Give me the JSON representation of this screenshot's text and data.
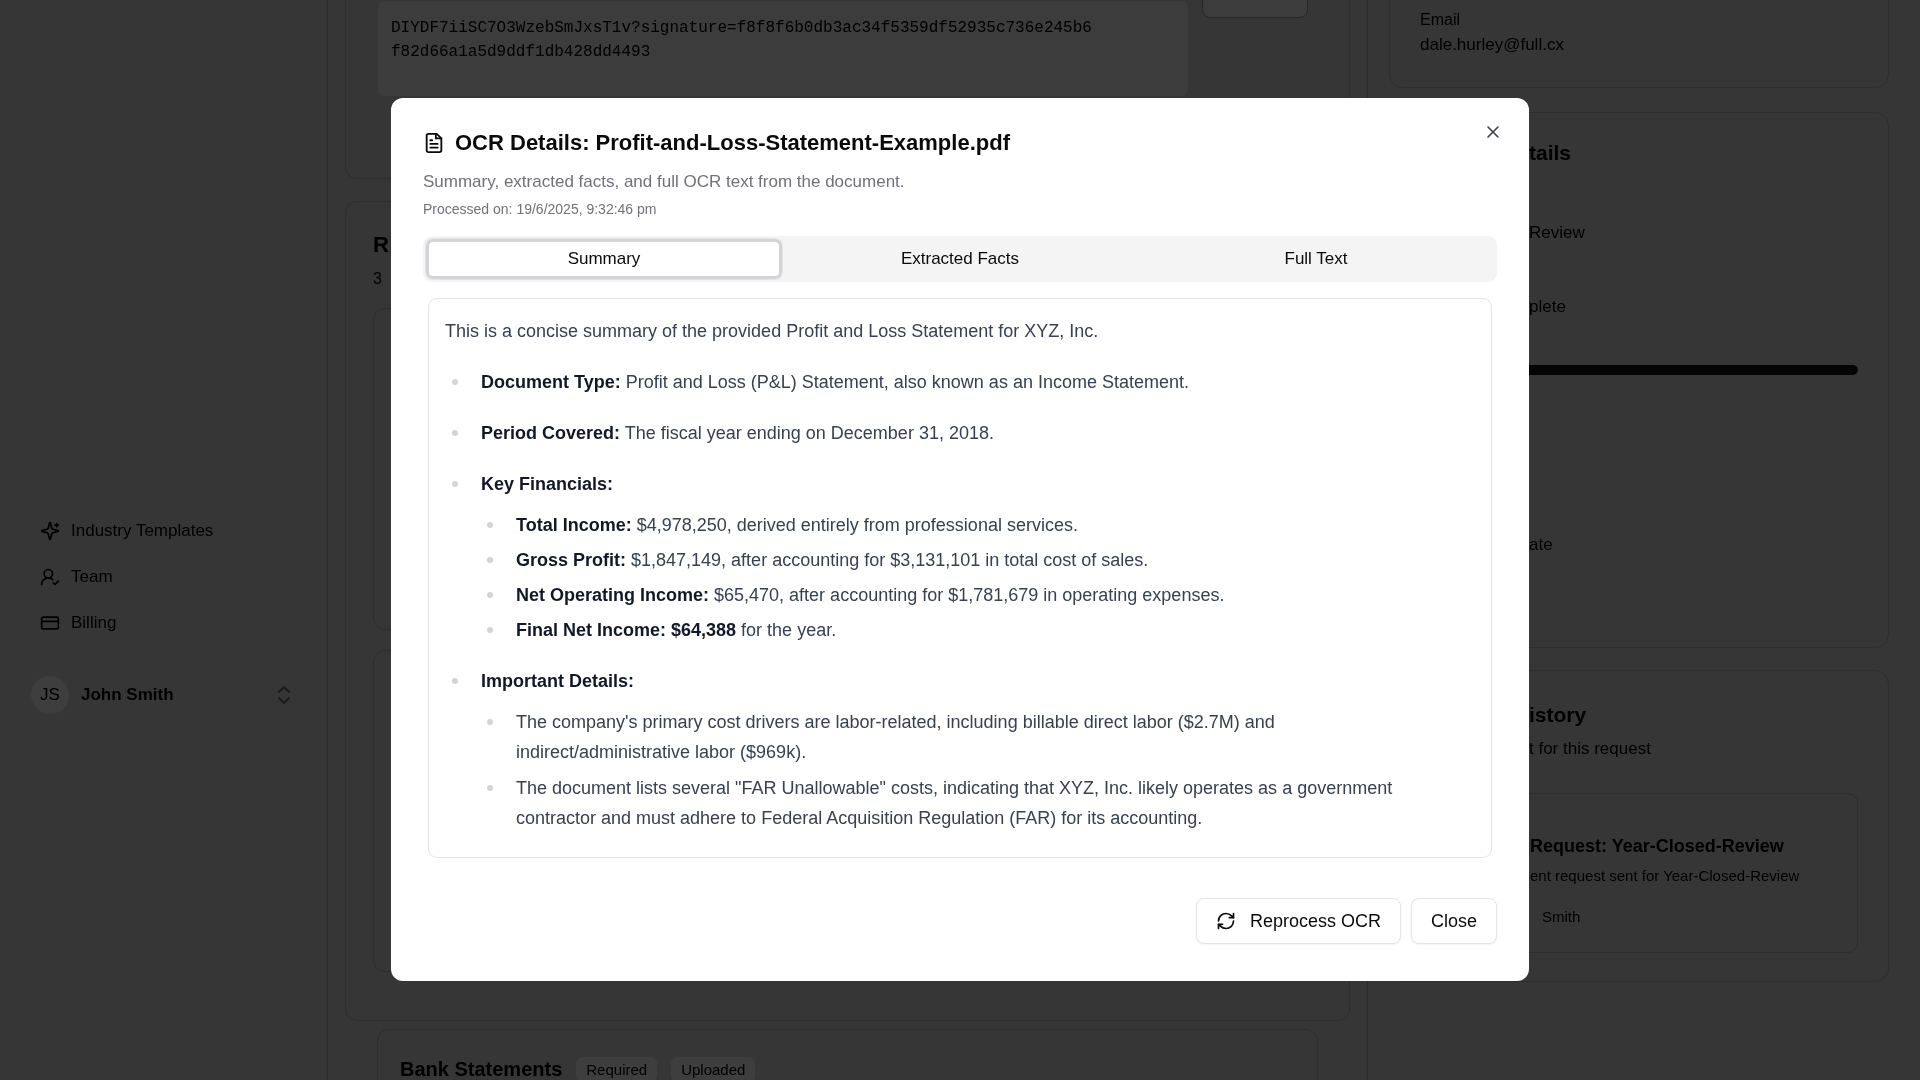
{
  "sidebar": {
    "items": [
      {
        "label": "Industry Templates"
      },
      {
        "label": "Team"
      },
      {
        "label": "Billing"
      }
    ],
    "user": {
      "initials": "JS",
      "name": "John Smith"
    }
  },
  "main": {
    "link_lines": [
      "DIYDF7iiSC7O3WzebSmJxsT1v?signature=f8f8f6b0db3ac34f5359df52935c736e245b6",
      "f82d66a1a5d9ddf1db428dd4493"
    ],
    "section_heading": "R",
    "section_sub": "3",
    "next_section": {
      "title": "Bank Statements",
      "badges": [
        "Required",
        "Uploaded"
      ]
    }
  },
  "right": {
    "email_label": "Email",
    "email": "dale.hurley@full.cx",
    "details": {
      "title": "tails",
      "status": "Review",
      "progress_label": "plete",
      "level": 1,
      "date_label": "ate"
    },
    "history": {
      "title": "istory",
      "subtitle": "t for this request",
      "entry": {
        "title": "Request: Year-Closed-Review",
        "text": "ent request sent for Year-Closed-Review",
        "author": "Smith"
      }
    }
  },
  "dialog": {
    "title": "OCR Details: Profit-and-Loss-Statement-Example.pdf",
    "subtitle": "Summary, extracted facts, and full OCR text from the document.",
    "processed": "Processed on: 19/6/2025, 9:32:46 pm",
    "tabs": [
      {
        "label": "Summary",
        "selected": true
      },
      {
        "label": "Extracted Facts",
        "selected": false
      },
      {
        "label": "Full Text",
        "selected": false
      }
    ],
    "summary": {
      "intro": "This is a concise summary of the provided Profit and Loss Statement for XYZ, Inc.",
      "items": [
        {
          "label": "Document Type:",
          "text": "Profit and Loss (P&L) Statement, also known as an Income Statement."
        },
        {
          "label": "Period Covered:",
          "text": "The fiscal year ending on December 31, 2018."
        },
        {
          "label": "Key Financials:",
          "children": [
            {
              "label": "Total Income:",
              "text": "$4,978,250, derived entirely from professional services."
            },
            {
              "label": "Gross Profit:",
              "text": "$1,847,149, after accounting for $3,131,101 in total cost of sales."
            },
            {
              "label": "Net Operating Income:",
              "text": "$65,470, after accounting for $1,781,679 in operating expenses."
            },
            {
              "label": "Final Net Income: $64,388",
              "text": "for the year."
            }
          ]
        },
        {
          "label": "Important Details:",
          "children": [
            {
              "text": "The company's primary cost drivers are labor-related, including billable direct labor ($2.7M) and indirect/administrative labor ($969k)."
            },
            {
              "text": "The document lists several \"FAR Unallowable\" costs, indicating that XYZ, Inc. likely operates as a government contractor and must adhere to Federal Acquisition Regulation (FAR) for its accounting."
            }
          ]
        }
      ]
    },
    "buttons": [
      {
        "kind": "reprocess",
        "label": "Reprocess OCR"
      },
      {
        "kind": "close",
        "label": "Close"
      }
    ]
  }
}
